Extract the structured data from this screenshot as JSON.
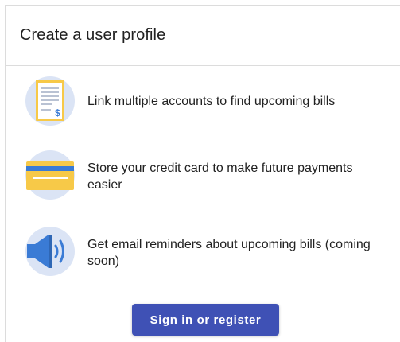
{
  "card": {
    "title": "Create a user profile"
  },
  "features": [
    {
      "icon": "bill-document-icon",
      "text": "Link multiple accounts to find upcoming bills"
    },
    {
      "icon": "credit-card-icon",
      "text": "Store your credit card to make future payments easier"
    },
    {
      "icon": "megaphone-icon",
      "text": "Get email reminders about upcoming bills (coming soon)"
    }
  ],
  "actions": {
    "signin_label": "Sign in or register"
  },
  "colors": {
    "accent": "#3f51b5",
    "icon_circle": "#dbe4f5",
    "icon_yellow": "#f7c948",
    "icon_blue": "#3a7bd5"
  }
}
